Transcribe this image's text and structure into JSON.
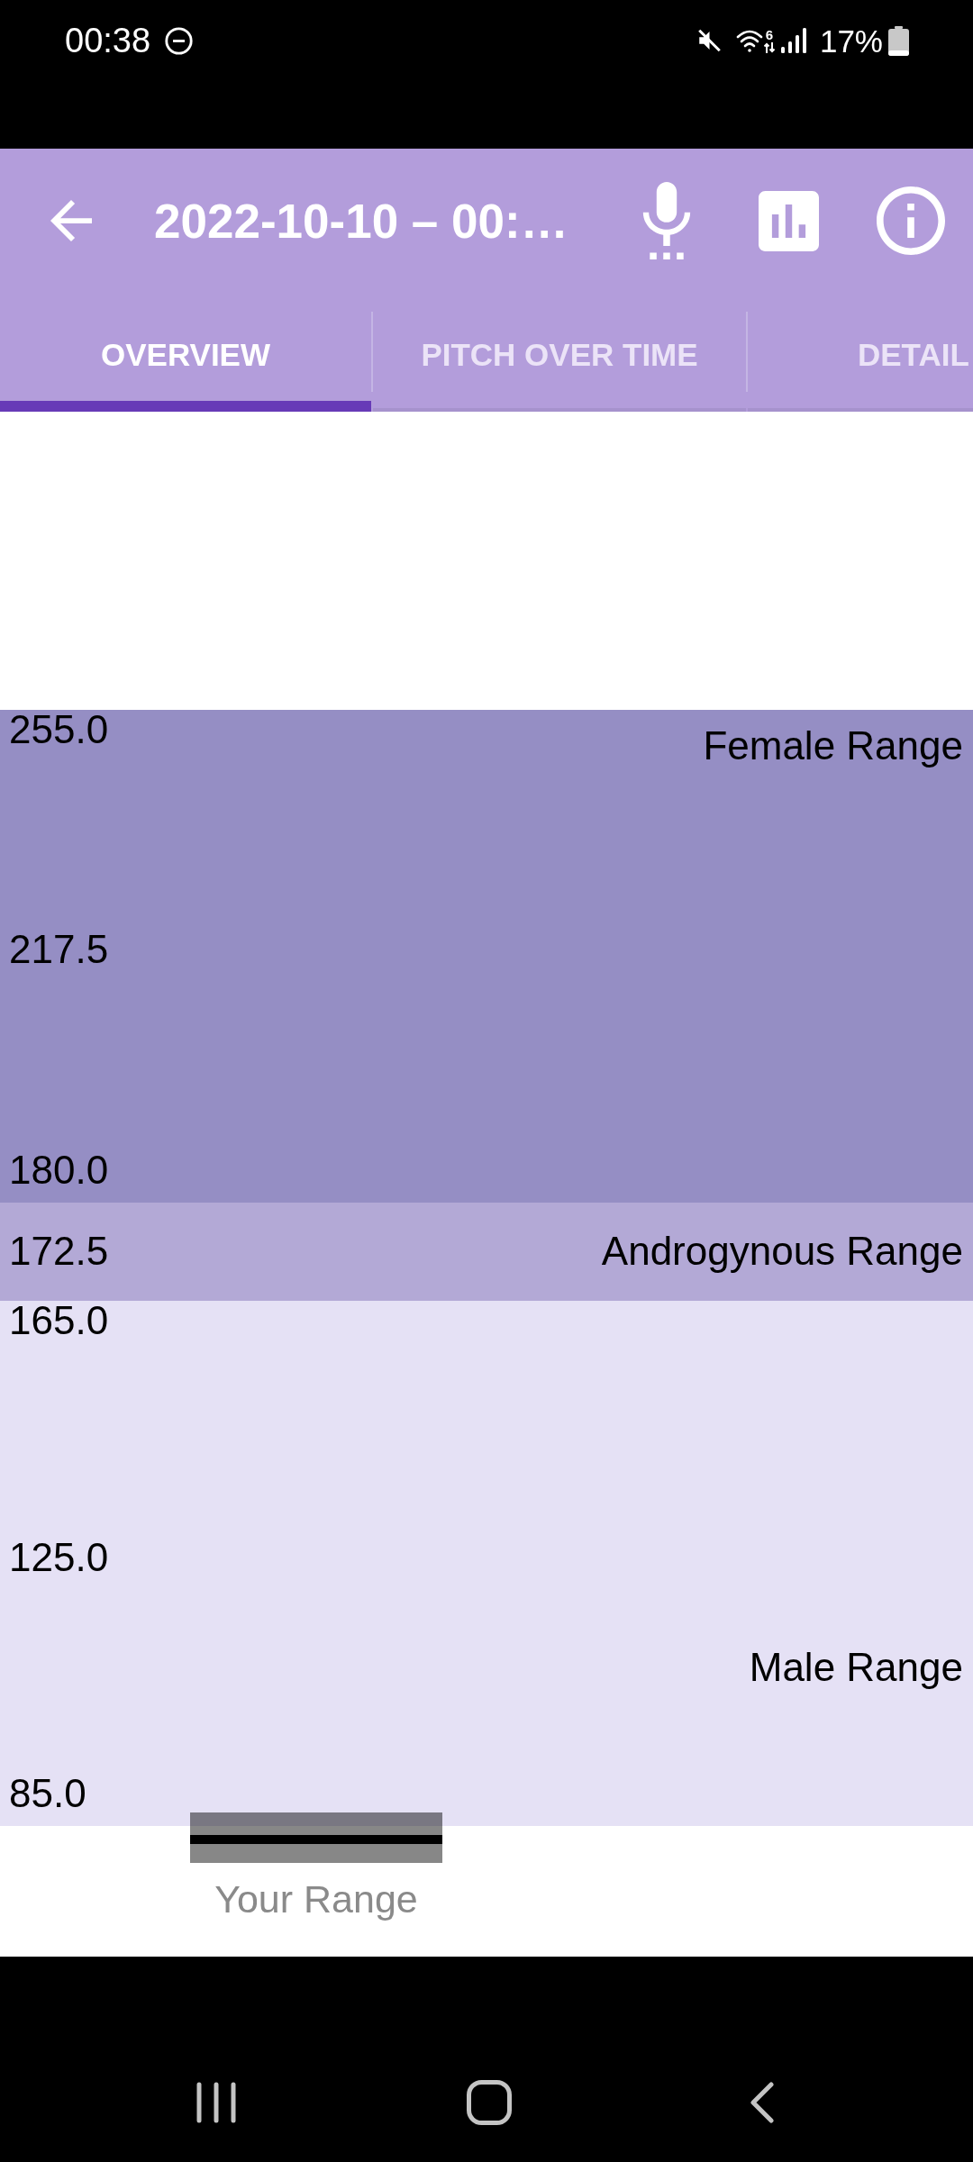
{
  "status_bar": {
    "time": "00:38",
    "wifi_badge": "6",
    "battery": "17%"
  },
  "app_bar": {
    "title": "2022-10-10 – 00:…"
  },
  "tabs": [
    {
      "label": "OVERVIEW",
      "selected": true
    },
    {
      "label": "PITCH OVER TIME",
      "selected": false
    },
    {
      "label": "DETAIL",
      "selected": false
    }
  ],
  "chart": {
    "bands": [
      {
        "label": "Female Range",
        "color": "#958ec4",
        "ticks": [
          "255.0",
          "217.5",
          "180.0"
        ]
      },
      {
        "label": "Androgynous Range",
        "color": "#b3a9d6",
        "ticks": [
          "172.5"
        ]
      },
      {
        "label": "Male Range",
        "color": "#e5e1f5",
        "ticks": [
          "165.0",
          "125.0",
          "85.0"
        ]
      }
    ],
    "category": "Your Range"
  }
}
